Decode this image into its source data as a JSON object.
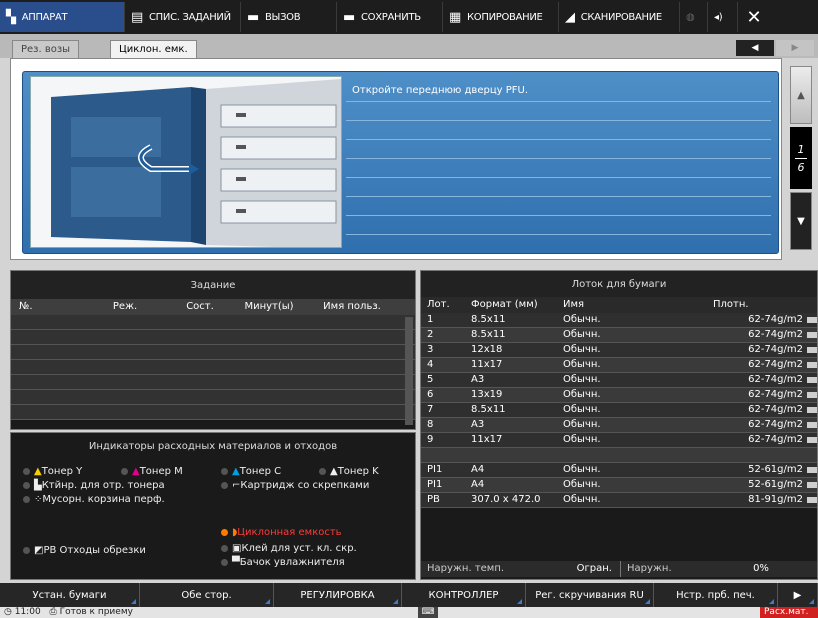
{
  "topbar": {
    "tabs": [
      {
        "label": "АППАРАТ",
        "icon": "machine-icon"
      },
      {
        "label": "СПИС. ЗАДАНИЙ",
        "icon": "list-icon"
      },
      {
        "label": "ВЫЗОВ",
        "icon": "recall-icon"
      },
      {
        "label": "СОХРАНИТЬ",
        "icon": "save-icon"
      },
      {
        "label": "КОПИРОВАНИЕ",
        "icon": "copy-icon"
      },
      {
        "label": "СКАНИРОВАНИЕ",
        "icon": "scan-icon"
      }
    ],
    "close": "✕"
  },
  "subtabs": {
    "left": "Рез. возы",
    "right": "Циклон. емк."
  },
  "message": {
    "text": "Откройте переднюю дверцу PFU."
  },
  "pager": {
    "current": "1",
    "total": "6"
  },
  "jobs": {
    "title": "Задание",
    "columns": [
      "№.",
      "Реж.",
      "Сост.",
      "Минут(ы)",
      "Имя польз."
    ]
  },
  "indicators": {
    "title": "Индикаторы расходных материалов и отходов",
    "items": [
      "Тонер Y",
      "Тонер M",
      "Тонер C",
      "Тонер K",
      "Ктйнр. для отр. тонера",
      "Картридж со скрепками",
      "Мусорн. корзина перф.",
      "Циклонная емкость",
      "РВ Отходы обрезки",
      "Клей для уст. кл. скр.",
      "Бачок увлажнителя"
    ]
  },
  "tray": {
    "title": "Лоток для бумаги",
    "columns": [
      "Лот.",
      "Формат (мм)",
      "Имя",
      "Плотн."
    ],
    "rows": [
      [
        "1",
        "8.5x11",
        "Обычн.",
        "62-74g/m2"
      ],
      [
        "2",
        "8.5x11",
        "Обычн.",
        "62-74g/m2"
      ],
      [
        "3",
        "12x18",
        "Обычн.",
        "62-74g/m2"
      ],
      [
        "4",
        "11x17",
        "Обычн.",
        "62-74g/m2"
      ],
      [
        "5",
        "A3",
        "Обычн.",
        "62-74g/m2"
      ],
      [
        "6",
        "13x19",
        "Обычн.",
        "62-74g/m2"
      ],
      [
        "7",
        "8.5x11",
        "Обычн.",
        "62-74g/m2"
      ],
      [
        "8",
        "A3",
        "Обычн.",
        "62-74g/m2"
      ],
      [
        "9",
        "11x17",
        "Обычн.",
        "62-74g/m2"
      ],
      [
        "",
        "",
        "",
        ""
      ],
      [
        "PI1",
        "A4",
        "Обычн.",
        "52-61g/m2"
      ],
      [
        "PI1",
        "A4",
        "Обычн.",
        "52-61g/m2"
      ],
      [
        "PB",
        "307.0 x 472.0",
        "Обычн.",
        "81-91g/m2"
      ]
    ],
    "footer": {
      "temp_label": "Наружн. темп.",
      "temp_val": "Огран.",
      "hum_label": "Наружн. влажн.",
      "hum_val": "0%"
    }
  },
  "bottom": [
    "Устан. бумаги",
    "Обе стор.",
    "РЕГУЛИРОВКА",
    "КОНТРОЛЛЕР",
    "Рег. скручивания RU",
    "Нстр. прб. печ."
  ],
  "status": {
    "time": "11:00",
    "text": "Готов к приему",
    "alert": "Расх.мат."
  }
}
